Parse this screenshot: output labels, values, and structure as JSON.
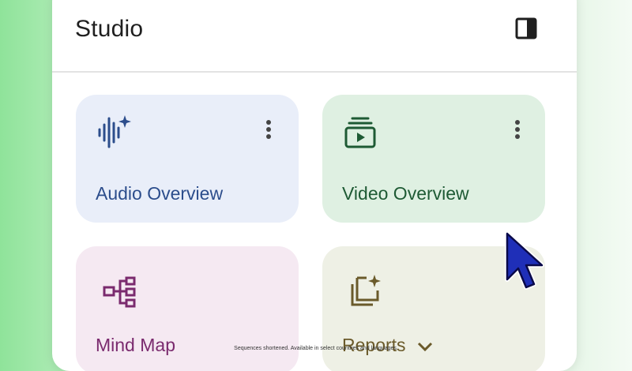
{
  "studio": {
    "title": "Studio",
    "panel_toggle_icon": "side-panel-icon"
  },
  "cards": [
    {
      "label": "Audio Overview",
      "icon": "audio-waveform-sparkle-icon",
      "color": "#2c4d8c",
      "bg": "#e9eef9",
      "has_menu": true
    },
    {
      "label": "Video Overview",
      "icon": "video-play-stack-icon",
      "color": "#1e5a34",
      "bg": "#dff0e2",
      "has_menu": true
    },
    {
      "label": "Mind Map",
      "icon": "mind-map-icon",
      "color": "#7a2a6e",
      "bg": "#f5e9f2",
      "has_menu": false
    },
    {
      "label": "Reports",
      "icon": "reports-sparkle-icon",
      "color": "#6a5a2a",
      "bg": "#eef0e5",
      "has_menu": false,
      "dropdown_icon": "chevron-down-icon"
    }
  ],
  "caption": "Sequences shortened. Available in select countries and languages.",
  "cursor_icon": "mouse-pointer-icon"
}
